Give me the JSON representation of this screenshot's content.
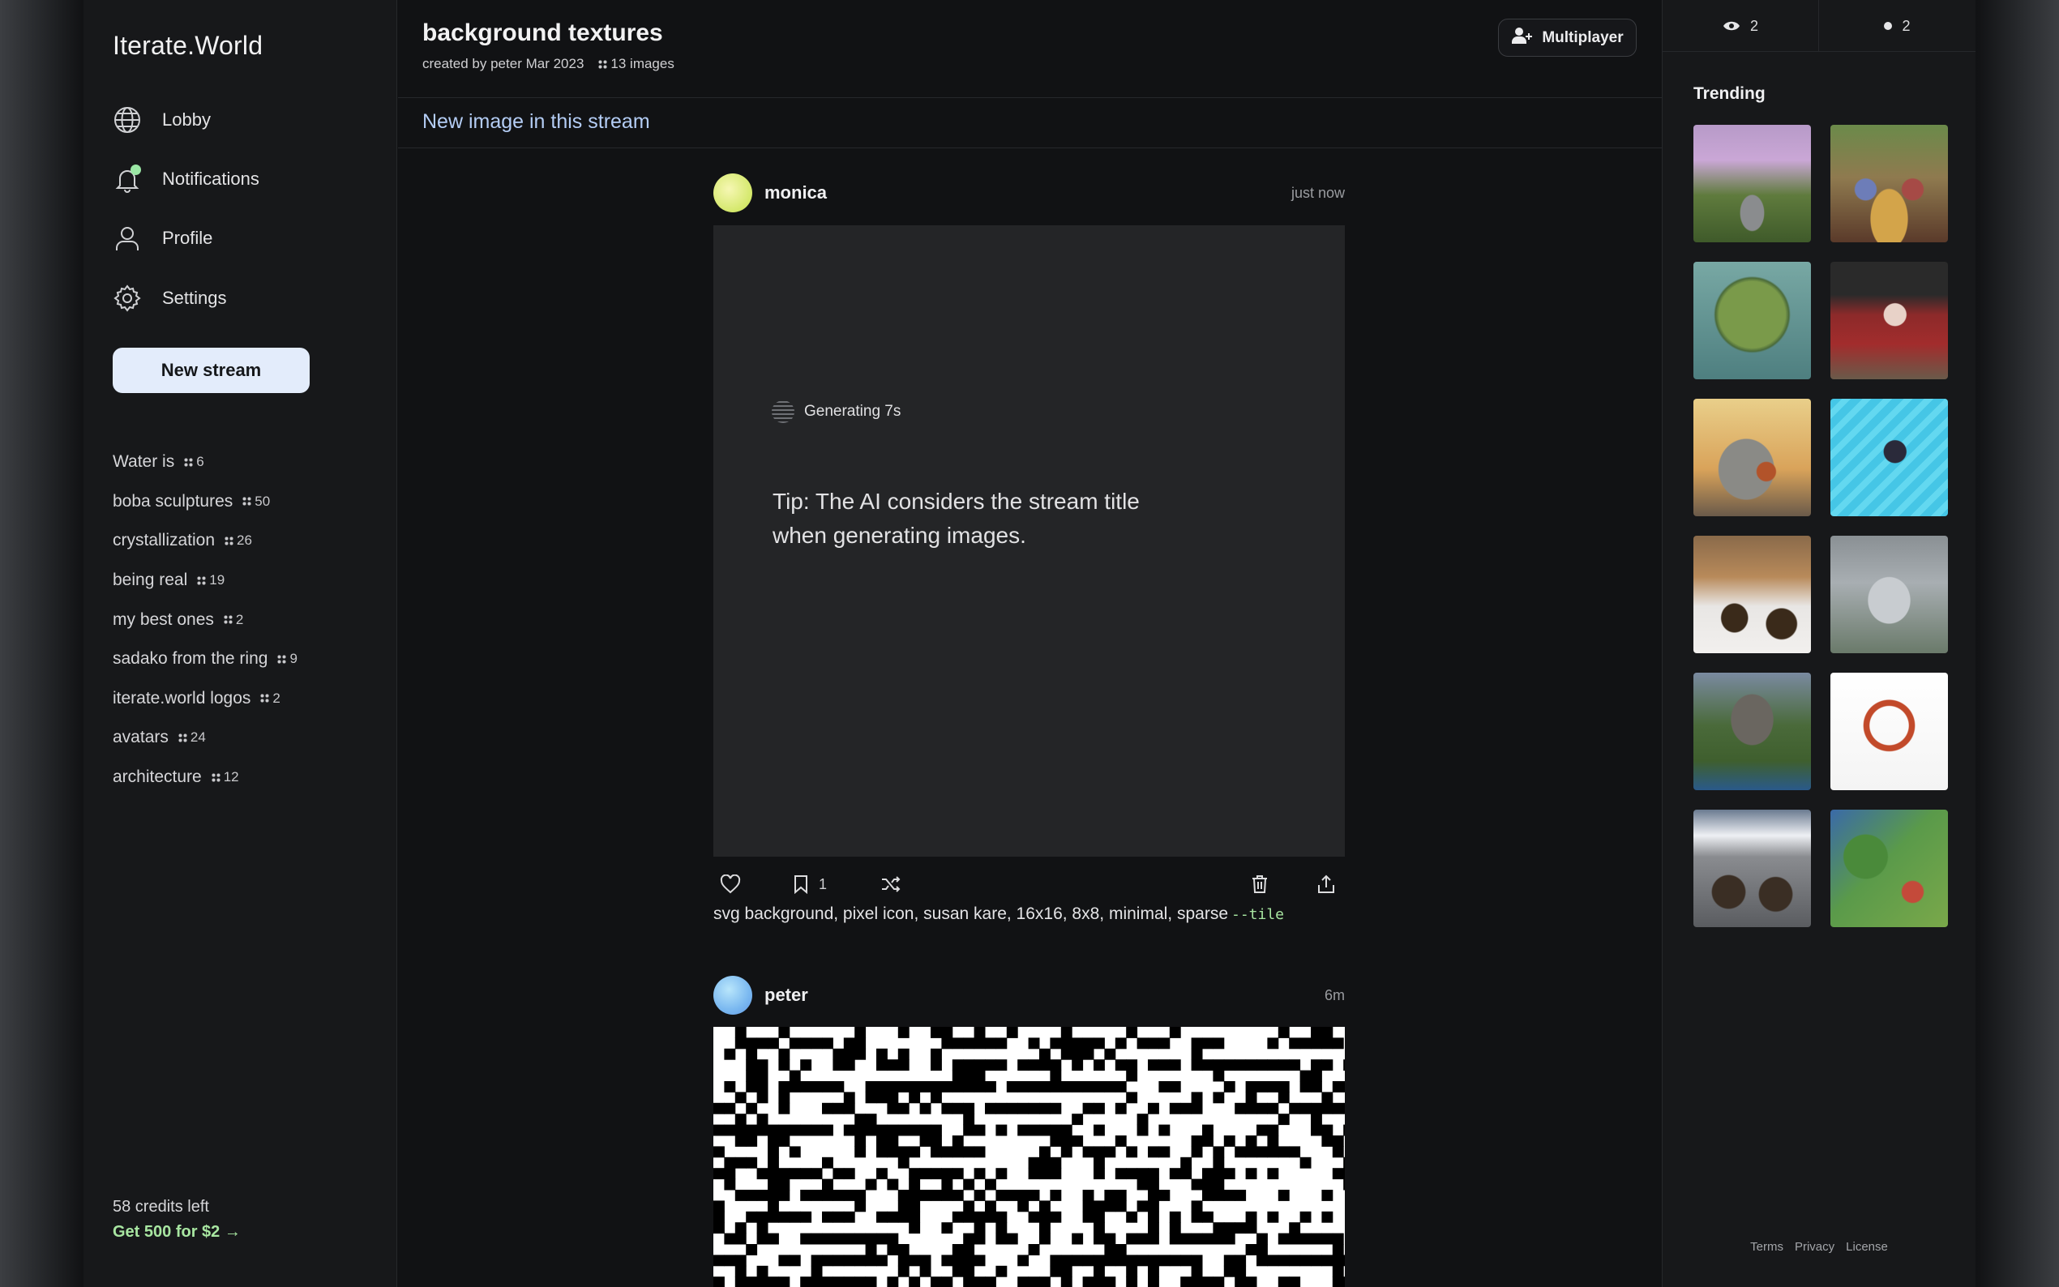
{
  "app": {
    "name": "Iterate.World"
  },
  "nav": [
    {
      "label": "Lobby",
      "icon": "globe-icon"
    },
    {
      "label": "Notifications",
      "icon": "bell-icon"
    },
    {
      "label": "Profile",
      "icon": "user-icon"
    },
    {
      "label": "Settings",
      "icon": "gear-icon"
    }
  ],
  "new_stream_label": "New stream",
  "streams": [
    {
      "name": "Water is",
      "count": "6"
    },
    {
      "name": "boba sculptures",
      "count": "50"
    },
    {
      "name": "crystallization",
      "count": "26"
    },
    {
      "name": "being real",
      "count": "19"
    },
    {
      "name": "my best ones",
      "count": "2"
    },
    {
      "name": "sadako from the ring",
      "count": "9"
    },
    {
      "name": "iterate.world logos",
      "count": "2"
    },
    {
      "name": "avatars",
      "count": "24"
    },
    {
      "name": "architecture",
      "count": "12"
    }
  ],
  "credits": {
    "left": "58 credits left",
    "buy": "Get 500 for $2 →"
  },
  "header": {
    "title": "background textures",
    "created": "created by peter Mar 2023",
    "images": "13 images",
    "multiplayer": "Multiplayer"
  },
  "new_image_link": "New image in this stream",
  "posts": [
    {
      "user": "monica",
      "time": "just now",
      "status": "Generating 7s",
      "tip": "Tip: The AI considers the stream title when generating images.",
      "bookmarks": "1",
      "prompt": "svg background, pixel icon, susan kare, 16x16, 8x8, minimal, sparse",
      "flag": "--tile"
    },
    {
      "user": "peter",
      "time": "6m"
    }
  ],
  "presence": {
    "viewers": "2",
    "online": "2"
  },
  "trending": {
    "title": "Trending",
    "items": [
      "garden-teapot",
      "mad-hatter-tea-party",
      "floating-island",
      "mad-hatter-portrait",
      "liberty-basketball",
      "pool-diver",
      "dachshund-village",
      "robot-waterfall",
      "fantasy-castle",
      "rollercoaster-drawing",
      "mountain-hobbits",
      "mushroom-village"
    ]
  },
  "footer": {
    "terms": "Terms",
    "privacy": "Privacy",
    "license": "License"
  }
}
